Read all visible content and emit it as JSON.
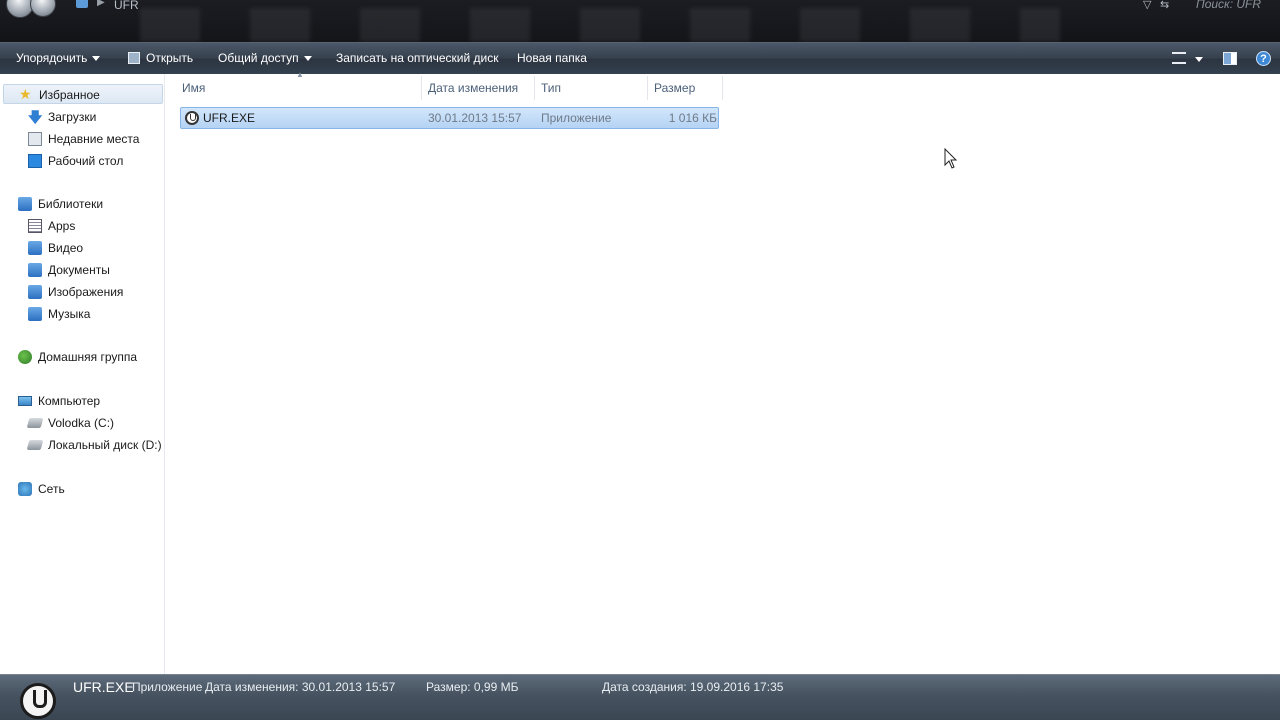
{
  "titlebar": {
    "path": "UFR",
    "search_placeholder": "Поиск: UFR"
  },
  "toolbar": {
    "organize": "Упорядочить",
    "open": "Открыть",
    "share": "Общий доступ",
    "burn": "Записать на оптический диск",
    "new_folder": "Новая папка",
    "help": "?"
  },
  "sidebar": {
    "favorites": "Избранное",
    "downloads": "Загрузки",
    "recent": "Недавние места",
    "desktop": "Рабочий стол",
    "libraries": "Библиотеки",
    "apps": "Apps",
    "video": "Видео",
    "documents": "Документы",
    "images": "Изображения",
    "music": "Музыка",
    "homegroup": "Домашняя группа",
    "computer": "Компьютер",
    "drive_c": "Volodka (C:)",
    "drive_d": "Локальный диск (D:)",
    "network": "Сеть"
  },
  "columns": {
    "name": "Имя",
    "date": "Дата изменения",
    "type": "Тип",
    "size": "Размер"
  },
  "files": [
    {
      "name": "UFR.EXE",
      "date": "30.01.2013 15:57",
      "type": "Приложение",
      "size": "1 016 КБ"
    }
  ],
  "details": {
    "name": "UFR.EXE",
    "type": "Приложение",
    "modified": "Дата изменения: 30.01.2013 15:57",
    "size": "Размер: 0,99 МБ",
    "created": "Дата создания: 19.09.2016 17:35"
  }
}
